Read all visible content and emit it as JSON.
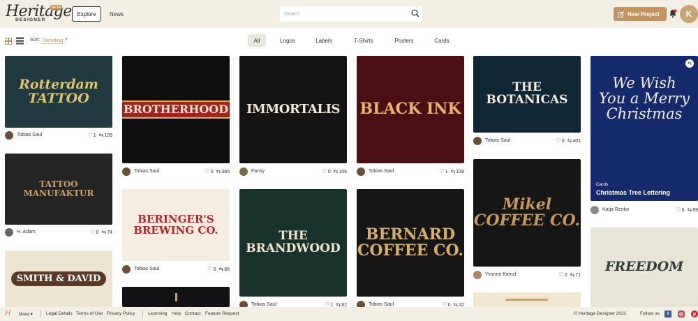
{
  "header": {
    "logo_main": "Heritage",
    "logo_sub": "DESIGNER",
    "logo_badge": "BETA",
    "nav": [
      "Explore",
      "News"
    ],
    "search_placeholder": "Search",
    "new_project": "New Project",
    "user_initial": "K",
    "colors": {
      "bar": "#f3efe5",
      "accent": "#c49360"
    }
  },
  "filters": {
    "sort_label": "Sort:",
    "sort_value": "Trending",
    "tabs": [
      "All",
      "Logos",
      "Labels",
      "T-Shirts",
      "Posters",
      "Cards"
    ],
    "active_tab": "All"
  },
  "cards": [
    {
      "art": "Rotterdam\nTATTOO",
      "author": "Tobias Saul",
      "likes": "1",
      "remixes": "105"
    },
    {
      "art": "TATTOO\nMANUFAKTUR",
      "author": "H. Adam",
      "likes": "0",
      "remixes": "74"
    },
    {
      "art": "SMITH & DAVID",
      "author": "",
      "likes": "",
      "remixes": ""
    },
    {
      "art": "BROTHERHOOD",
      "author": "Tobias Saul",
      "likes": "0",
      "remixes": "380"
    },
    {
      "art": "BERINGER'S\nBREWING CO.",
      "author": "Tobias Saul",
      "likes": "0",
      "remixes": "86"
    },
    {
      "art": "",
      "author": "",
      "likes": "",
      "remixes": ""
    },
    {
      "art": "IMMORTALIS",
      "author": "Fansy",
      "likes": "0",
      "remixes": "106"
    },
    {
      "art": "THE\nBRANDWOOD",
      "author": "Tobias Saul",
      "likes": "1",
      "remixes": "82"
    },
    {
      "art": "BLACK INK",
      "author": "Tobias Saul",
      "likes": "1",
      "remixes": "139"
    },
    {
      "art": "BERNARD\nCOFFEE CO.",
      "author": "Tobias Saul",
      "likes": "0",
      "remixes": "32"
    },
    {
      "art": "THE\nBOTANICAS",
      "author": "Tobias Saul",
      "likes": "0",
      "remixes": "401"
    },
    {
      "art": "Mikel\nCOFFEE CO.",
      "author": "Yvonne Kienzl",
      "likes": "0",
      "remixes": "71"
    },
    {
      "art": "",
      "author": "",
      "likes": "",
      "remixes": ""
    },
    {
      "art": "We Wish You a Merry Christmas",
      "category": "Cards",
      "title": "Christmas Tree Lettering",
      "author": "Katja Renko",
      "likes": "0",
      "remixes": "89"
    },
    {
      "art": "FREEDOM",
      "author": "",
      "likes": "",
      "remixes": ""
    }
  ],
  "footer": {
    "more": "More",
    "links": [
      "Legal Details",
      "Terms of Use",
      "Privacy Policy",
      "Licensing",
      "Help",
      "Contact",
      "Feature Request"
    ],
    "copyright": "© Heritage Designer 2021",
    "follow": "Follow us:"
  }
}
